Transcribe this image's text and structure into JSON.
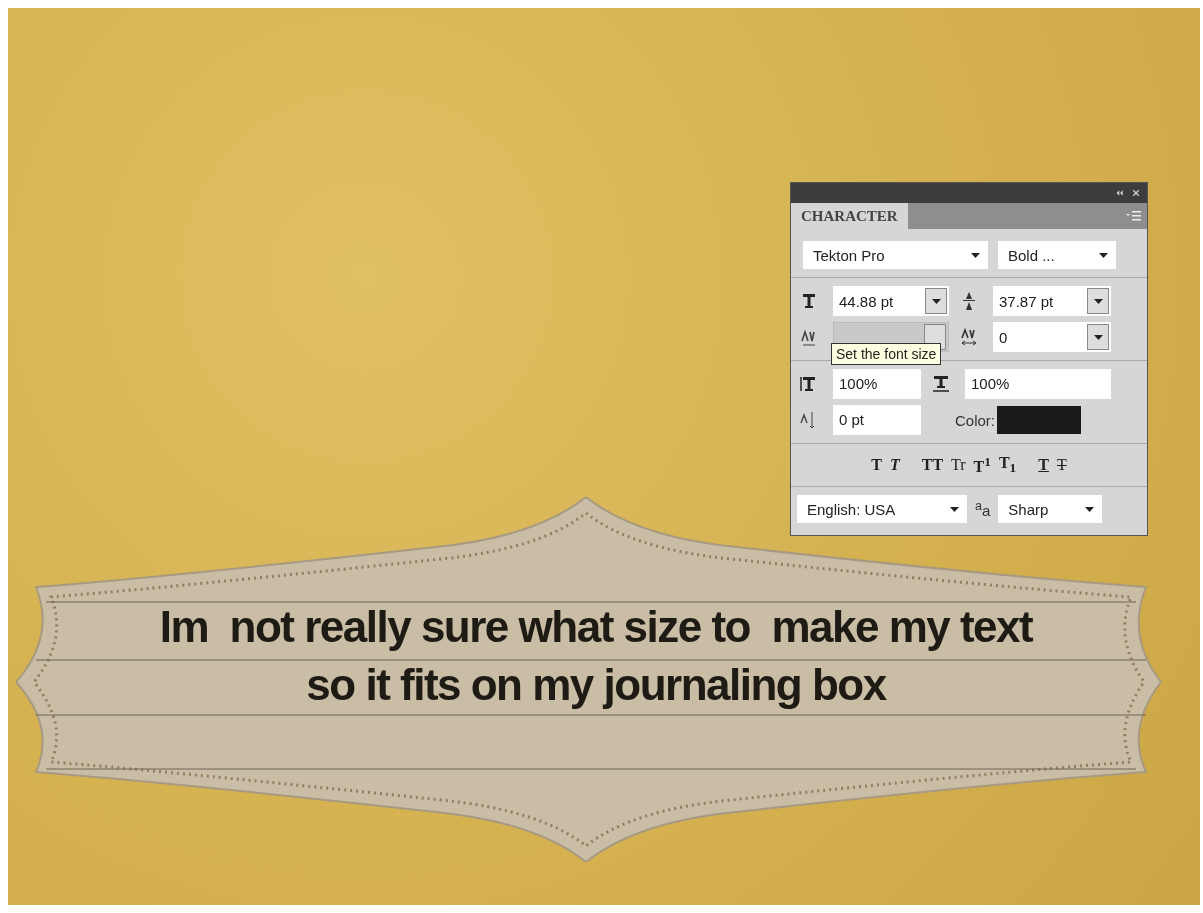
{
  "canvas": {
    "journaling_box": {
      "lines": [
        "Im  not really sure what size to  make my text",
        "so it fits on my journaling box"
      ]
    }
  },
  "character_panel": {
    "tab": {
      "label": "CHARACTER",
      "selected": true
    },
    "font_family": "Tekton Pro",
    "font_style": "Bold ...",
    "font_size": "44.88 pt",
    "leading": "37.87 pt",
    "kerning": {
      "disabled": true
    },
    "tracking": "0",
    "vertical_scale": "100%",
    "horizontal_scale": "100%",
    "baseline_shift": "0 pt",
    "color_label": "Color:",
    "color": "#1a1a1a",
    "style_buttons": [
      {
        "kind": "bold",
        "label": "T"
      },
      {
        "kind": "italic",
        "label": "T"
      },
      {
        "kind": "caps",
        "label": "TT"
      },
      {
        "kind": "smallcaps",
        "label": "Tr"
      },
      {
        "kind": "super",
        "label": "T$^{1}$"
      },
      {
        "kind": "sub",
        "label": "T$_{1}$"
      },
      {
        "kind": "underline",
        "label": "T"
      },
      {
        "kind": "strike",
        "label": "T"
      }
    ],
    "language": "English: USA",
    "antialias_label": "$^{a}$a",
    "antialias": "Sharp",
    "tooltip": "Set the font size"
  }
}
